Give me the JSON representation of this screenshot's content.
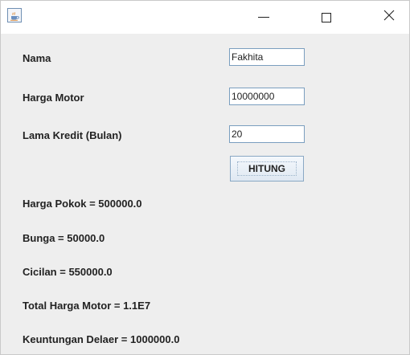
{
  "window": {
    "title": "",
    "icon": "java-coffee-icon",
    "controls": {
      "minimize": "minimize-icon",
      "maximize": "maximize-icon",
      "close": "close-icon"
    }
  },
  "form": {
    "nama_label": "Nama",
    "nama_value": "Fakhita",
    "harga_label": "Harga Motor",
    "harga_value": "10000000",
    "lama_label": "Lama Kredit (Bulan)",
    "lama_value": "20",
    "hitung_label": "HITUNG"
  },
  "results": {
    "harga_pokok": "Harga Pokok = 500000.0",
    "bunga": "Bunga = 50000.0",
    "cicilan": "Cicilan = 550000.0",
    "total_harga": "Total Harga Motor = 1.1E7",
    "keuntungan": "Keuntungan Delaer = 1000000.0"
  },
  "colors": {
    "window_bg": "#eeeeee",
    "titlebar_bg": "#ffffff",
    "field_border": "#7a9ebf"
  }
}
